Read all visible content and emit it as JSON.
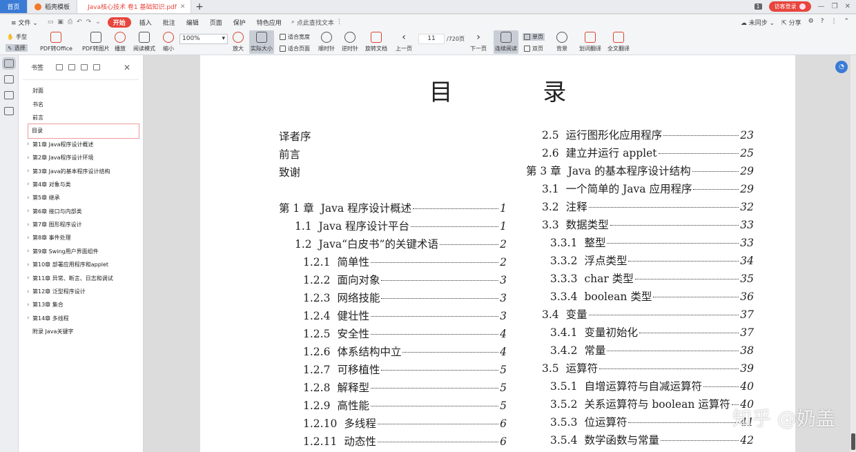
{
  "tabs": {
    "home": "首页",
    "template": "稻壳模板",
    "document": "Java核心技术 卷1 基础知识.pdf",
    "new_tab": "+"
  },
  "titlebar": {
    "count_badge": "1",
    "login": "访客登录"
  },
  "menu": {
    "file": "文件",
    "start": "开始",
    "items": [
      "插入",
      "批注",
      "编辑",
      "页面",
      "保护",
      "特色应用"
    ],
    "search": "点此查找文本",
    "sync": "未同步",
    "share": "分享"
  },
  "ribbon": {
    "hand": "手型",
    "select": "选择",
    "pdf_to_office": "PDF转Office",
    "pdf_to_image": "PDF转图片",
    "play": "播放",
    "read_mode": "阅读模式",
    "zoom_out": "缩小",
    "zoom_value": "100%",
    "zoom_in": "放大",
    "actual_size": "实际大小",
    "fit_width": "适合宽度",
    "fit_page": "适合页面",
    "clockwise": "顺时针",
    "counter_clockwise": "逆时针",
    "rotate_doc": "旋转文档",
    "prev_page": "上一页",
    "current_page": "11",
    "total_pages": "/720页",
    "next_page": "下一页",
    "continuous": "连续阅读",
    "single_page": "单页",
    "double_page": "双页",
    "background": "背景",
    "word_translate": "划词翻译",
    "full_translate": "全文翻译"
  },
  "bookmarks": {
    "title": "书签",
    "items": [
      "封面",
      "书名",
      "前言",
      "目录",
      "第1章 Java程序设计概述",
      "第2章 Java程序设计环境",
      "第3章 Java的基本程序设计结构",
      "第4章 对象与类",
      "第5章 继承",
      "第6章 接口与内部类",
      "第7章 图形程序设计",
      "第8章 事件处理",
      "第9章 Swing用户界面组件",
      "第10章 部署应用程序和applet",
      "第11章 异常、断言、日志和调试",
      "第12章 泛型程序设计",
      "第13章 集合",
      "第14章 多线程",
      "附录 Java关键字"
    ]
  },
  "page": {
    "title": "目 录",
    "left": [
      {
        "num": "",
        "text": "译者序",
        "page": ""
      },
      {
        "num": "",
        "text": "前言",
        "page": ""
      },
      {
        "num": "",
        "text": "致谢",
        "page": ""
      },
      {
        "num": "第 1 章",
        "text": "Java 程序设计概述",
        "page": "1"
      },
      {
        "num": "1.1",
        "text": "Java 程序设计平台",
        "page": "1"
      },
      {
        "num": "1.2",
        "text": "Java“白皮书”的关键术语",
        "page": "2"
      },
      {
        "num": "1.2.1",
        "text": "简单性",
        "page": "2"
      },
      {
        "num": "1.2.2",
        "text": "面向对象",
        "page": "3"
      },
      {
        "num": "1.2.3",
        "text": "网络技能",
        "page": "3"
      },
      {
        "num": "1.2.4",
        "text": "健壮性",
        "page": "3"
      },
      {
        "num": "1.2.5",
        "text": "安全性",
        "page": "4"
      },
      {
        "num": "1.2.6",
        "text": "体系结构中立",
        "page": "4"
      },
      {
        "num": "1.2.7",
        "text": "可移植性",
        "page": "5"
      },
      {
        "num": "1.2.8",
        "text": "解释型",
        "page": "5"
      },
      {
        "num": "1.2.9",
        "text": "高性能",
        "page": "5"
      },
      {
        "num": "1.2.10",
        "text": "多线程",
        "page": "6"
      },
      {
        "num": "1.2.11",
        "text": "动态性",
        "page": "6"
      }
    ],
    "right": [
      {
        "num": "2.5",
        "text": "运行图形化应用程序",
        "page": "23"
      },
      {
        "num": "2.6",
        "text": "建立并运行 applet",
        "page": "25"
      },
      {
        "num": "第 3 章",
        "text": "Java 的基本程序设计结构",
        "page": "29"
      },
      {
        "num": "3.1",
        "text": "一个简单的 Java 应用程序",
        "page": "29"
      },
      {
        "num": "3.2",
        "text": "注释",
        "page": "32"
      },
      {
        "num": "3.3",
        "text": "数据类型",
        "page": "33"
      },
      {
        "num": "3.3.1",
        "text": "整型",
        "page": "33"
      },
      {
        "num": "3.3.2",
        "text": "浮点类型",
        "page": "34"
      },
      {
        "num": "3.3.3",
        "text": "char 类型",
        "page": "35"
      },
      {
        "num": "3.3.4",
        "text": "boolean 类型",
        "page": "36"
      },
      {
        "num": "3.4",
        "text": "变量",
        "page": "37"
      },
      {
        "num": "3.4.1",
        "text": "变量初始化",
        "page": "37"
      },
      {
        "num": "3.4.2",
        "text": "常量",
        "page": "38"
      },
      {
        "num": "3.5",
        "text": "运算符",
        "page": "39"
      },
      {
        "num": "3.5.1",
        "text": "自增运算符与自减运算符",
        "page": "40"
      },
      {
        "num": "3.5.2",
        "text": "关系运算符与 boolean 运算符",
        "page": "40"
      },
      {
        "num": "3.5.3",
        "text": "位运算符",
        "page": "41"
      },
      {
        "num": "3.5.4",
        "text": "数学函数与常量",
        "page": "42"
      }
    ]
  },
  "watermark": "知乎 @奶盖",
  "colors": {
    "accent_red": "#e8453c",
    "home_blue": "#3a7bd5"
  }
}
